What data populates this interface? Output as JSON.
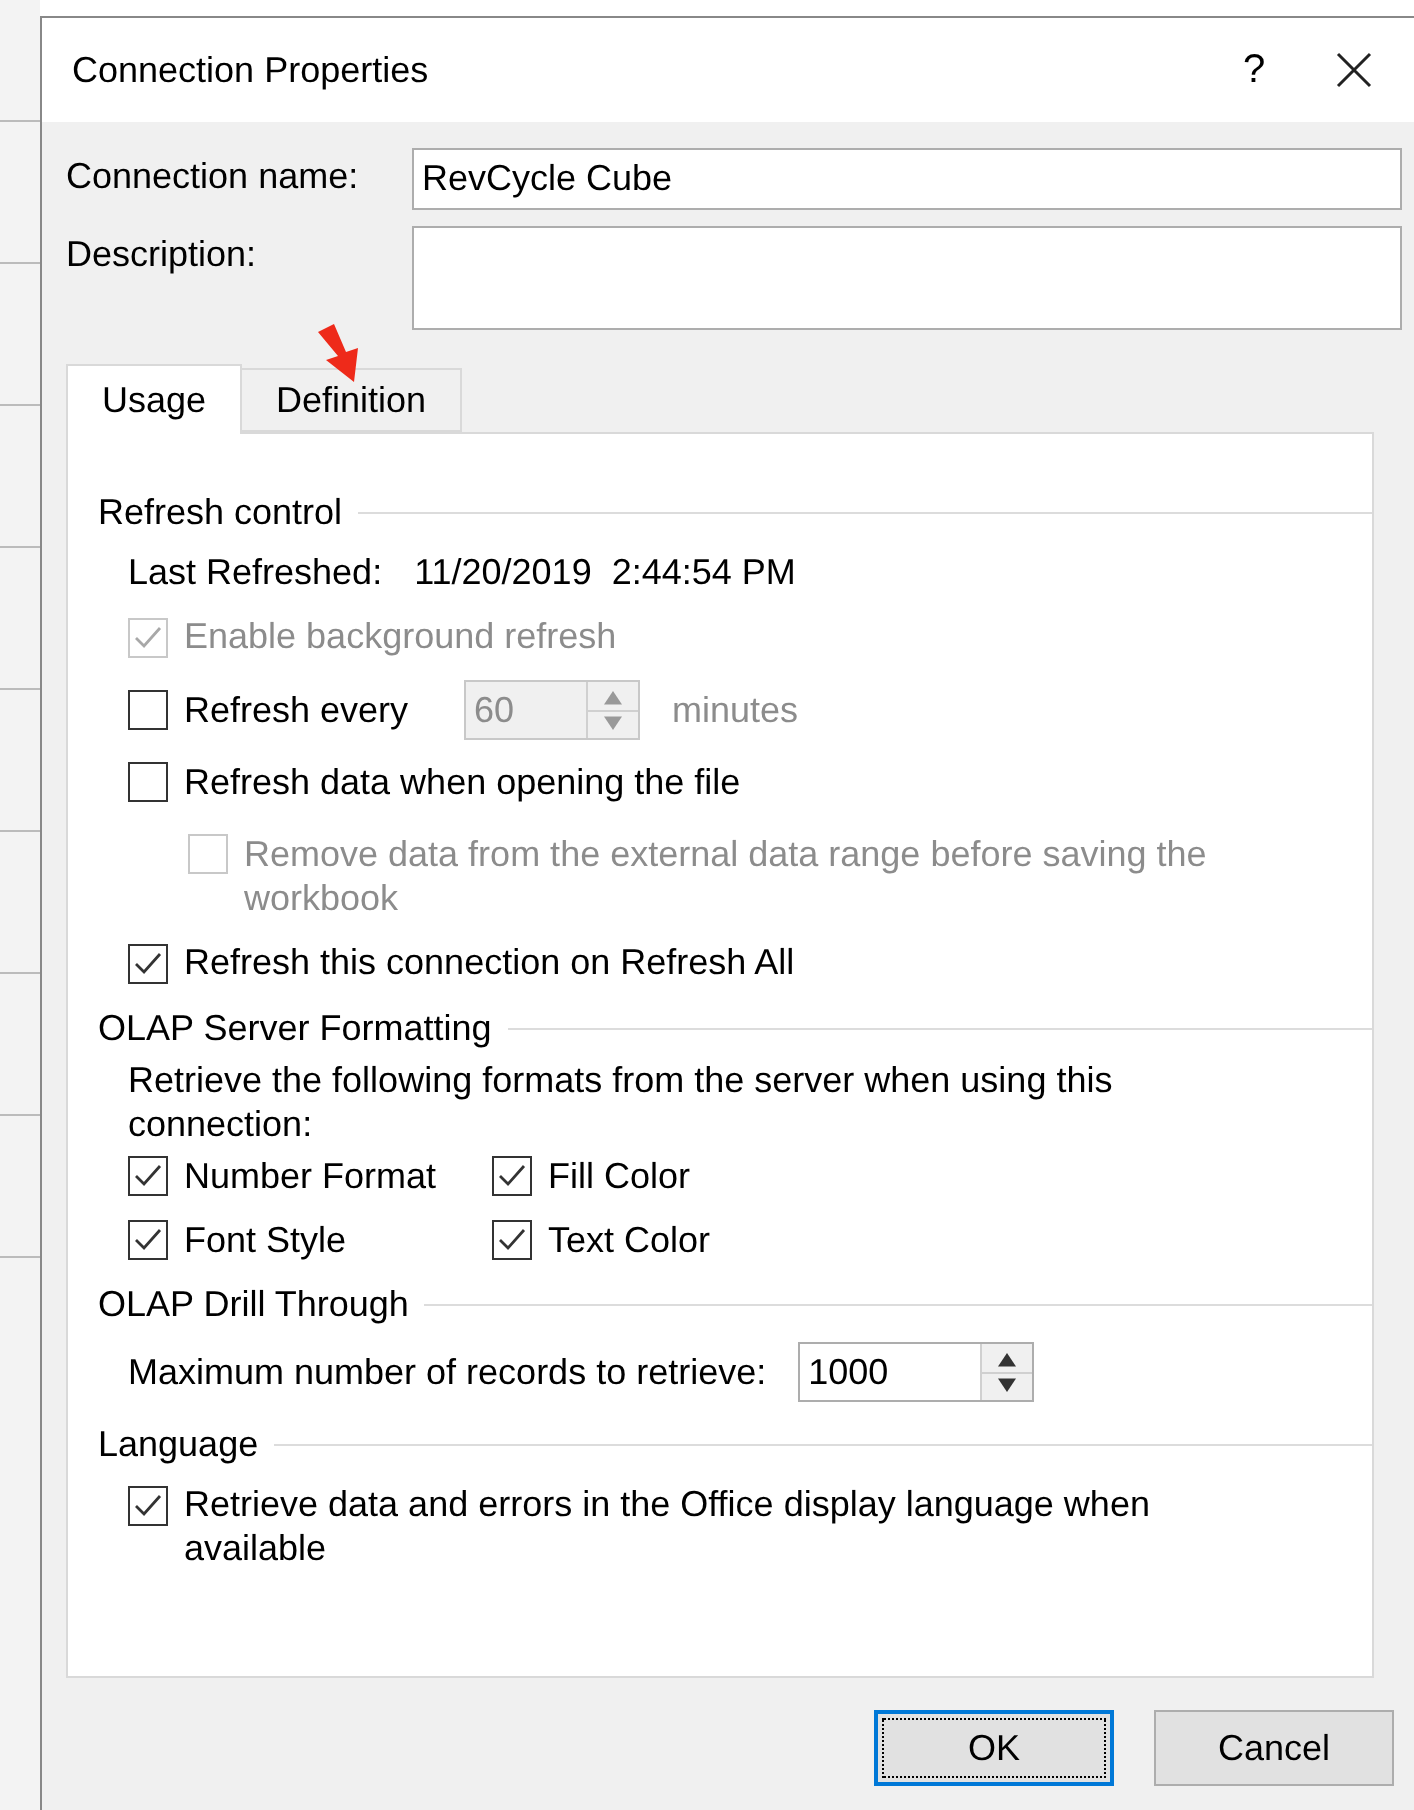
{
  "window": {
    "title": "Connection Properties",
    "help": "?"
  },
  "fields": [
    {
      "label": "Connection name:",
      "value": "RevCycle Cube",
      "kind": "line"
    },
    {
      "label": "Description:",
      "kind": "area"
    }
  ],
  "tabs": [
    {
      "label": "Usage",
      "selected": true
    },
    {
      "label": "Definition",
      "selected": false
    }
  ],
  "sections": [
    {
      "title": "Refresh control",
      "items": [
        {
          "kind": "info",
          "label": "Last Refreshed:",
          "value": "11/20/2019  2:44:54 PM"
        },
        {
          "kind": "checkbox",
          "label": "Enable background refresh",
          "checked": true,
          "disabled": true
        },
        {
          "kind": "spin",
          "label": "Refresh every",
          "checked": false,
          "disabled": false,
          "value": "60",
          "unit": "minutes",
          "field_disabled": true
        },
        {
          "kind": "checkbox",
          "label": "Refresh data when opening the file",
          "checked": false,
          "disabled": false,
          "children": [
            {
              "kind": "checkbox",
              "label": "Remove data from the external data range before saving the workbook",
              "checked": false,
              "disabled": true
            }
          ]
        },
        {
          "kind": "checkbox",
          "label": "Refresh this connection on Refresh All",
          "checked": true,
          "disabled": false
        }
      ]
    },
    {
      "title": "OLAP Server Formatting",
      "items": [
        {
          "kind": "text",
          "label": "Retrieve the following formats from the server when using this connection:"
        },
        {
          "kind": "grid",
          "options": [
            {
              "label": "Number Format",
              "checked": true
            },
            {
              "label": "Fill Color",
              "checked": true
            },
            {
              "label": "Font Style",
              "checked": true
            },
            {
              "label": "Text Color",
              "checked": true
            }
          ]
        }
      ]
    },
    {
      "title": "OLAP Drill Through",
      "items": [
        {
          "kind": "number",
          "label": "Maximum number of records to retrieve:",
          "value": "1000"
        }
      ]
    },
    {
      "title": "Language",
      "items": [
        {
          "kind": "checkbox",
          "label": "Retrieve data and errors in the Office display language when available",
          "checked": true,
          "disabled": false
        }
      ]
    }
  ],
  "buttons": [
    {
      "label": "OK",
      "default": true
    },
    {
      "label": "Cancel",
      "default": false
    }
  ]
}
